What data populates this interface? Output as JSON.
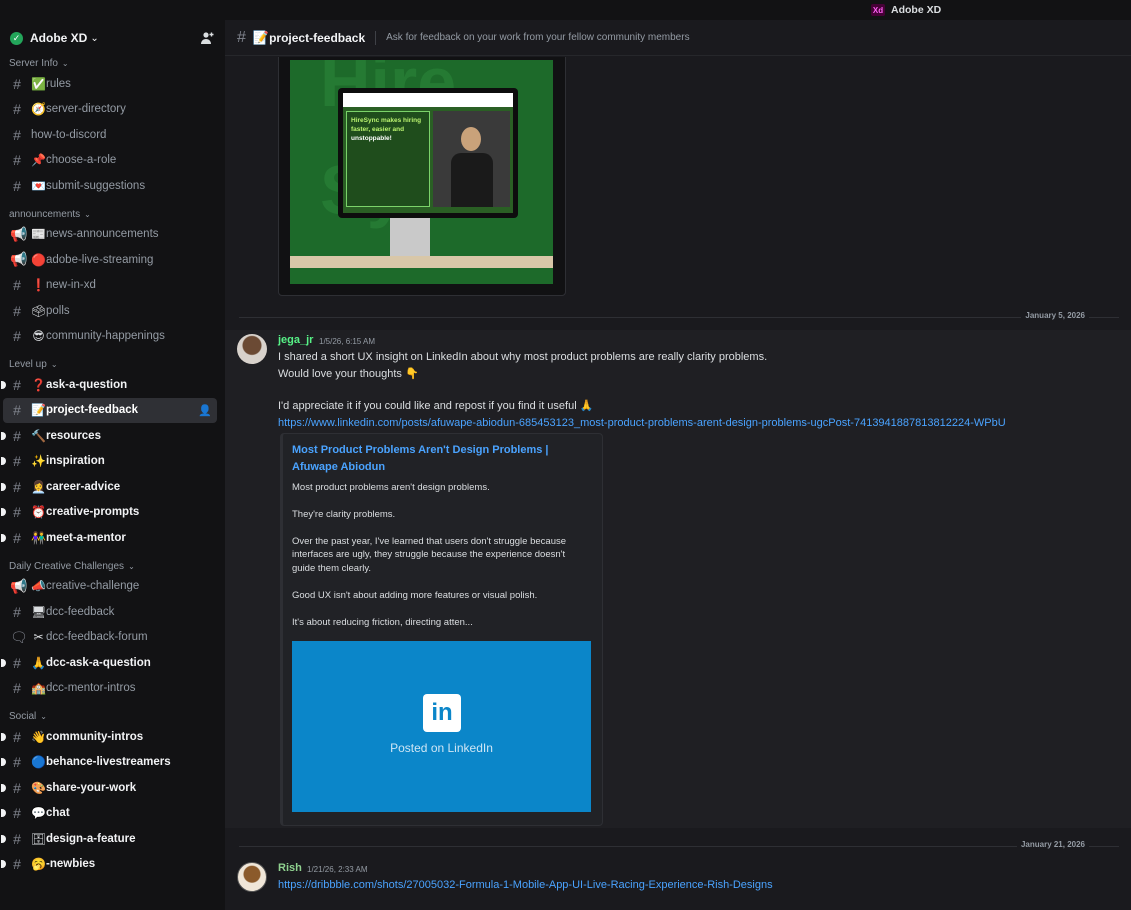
{
  "window": {
    "app_title": "Adobe XD",
    "logo": "Xd"
  },
  "server": {
    "name": "Adobe XD"
  },
  "categories": {
    "server_info": "Server Info",
    "announcements": "announcements",
    "level_up": "Level up",
    "daily": "Daily Creative Challenges",
    "social": "Social"
  },
  "channels": {
    "rules": {
      "emoji": "✅",
      "label": "rules"
    },
    "server_directory": {
      "emoji": "🧭",
      "label": "server-directory"
    },
    "how_to_discord": {
      "emoji": "",
      "label": "how-to-discord"
    },
    "choose_a_role": {
      "emoji": "📌",
      "label": "choose-a-role"
    },
    "submit_suggestions": {
      "emoji": "💌",
      "label": "submit-suggestions"
    },
    "news_announcements": {
      "emoji": "📰",
      "label": "news-announcements"
    },
    "adobe_live_streaming": {
      "emoji": "🔴",
      "label": "adobe-live-streaming"
    },
    "new_in_xd": {
      "emoji": "❗",
      "label": "new-in-xd"
    },
    "polls": {
      "emoji": "🗳",
      "label": "polls"
    },
    "community_happenings": {
      "emoji": "😎",
      "label": "community-happenings"
    },
    "ask_a_question": {
      "emoji": "❓",
      "label": "ask-a-question"
    },
    "project_feedback": {
      "emoji": "📝",
      "label": "project-feedback"
    },
    "resources": {
      "emoji": "🔨",
      "label": "resources"
    },
    "inspiration": {
      "emoji": "✨",
      "label": "inspiration"
    },
    "career_advice": {
      "emoji": "👩‍💼",
      "label": "career-advice"
    },
    "creative_prompts": {
      "emoji": "⏰",
      "label": "creative-prompts"
    },
    "meet_a_mentor": {
      "emoji": "👫",
      "label": "meet-a-mentor"
    },
    "creative_challenge": {
      "emoji": "📣",
      "label": "creative-challenge"
    },
    "dcc_feedback": {
      "emoji": "🖥",
      "label": "dcc-feedback"
    },
    "dcc_feedback_forum": {
      "emoji": "✂",
      "label": "dcc-feedback-forum"
    },
    "dcc_ask_a_question": {
      "emoji": "🙏",
      "label": "dcc-ask-a-question"
    },
    "dcc_mentor_intros": {
      "emoji": "🏫",
      "label": "dcc-mentor-intros"
    },
    "community_intros": {
      "emoji": "👋",
      "label": "community-intros"
    },
    "behance_livestreamers": {
      "emoji": "🔵",
      "label": "behance-livestreamers"
    },
    "share_your_work": {
      "emoji": "🎨",
      "label": "share-your-work"
    },
    "chat": {
      "emoji": "💬",
      "label": "chat"
    },
    "design_a_feature": {
      "emoji": "🗄",
      "label": "design-a-feature"
    },
    "newbies": {
      "emoji": "🥱",
      "label": "-newbies"
    }
  },
  "header": {
    "emoji": "📝",
    "channel": "project-feedback",
    "topic": "Ask for feedback on your work from your fellow community members"
  },
  "attachment": {
    "brand_word_1": "Hire",
    "brand_word_2": "Sync",
    "headline_1": "HireSync makes hiring",
    "headline_2": "faster, easier and",
    "headline_3": "unstoppable!"
  },
  "dividers": {
    "d1": "January 5, 2026",
    "d2": "January 21, 2026"
  },
  "messages": [
    {
      "author": "jega_jr",
      "timestamp": "1/5/26, 6:15 AM",
      "line1": "I shared a short UX insight on LinkedIn about why most product problems are really clarity problems.",
      "line2": "Would love your thoughts 👇",
      "line3": "I'd appreciate it if you could like and repost if you find it useful 🙏",
      "link": "https://www.linkedin.com/posts/afuwape-abiodun-685453123_most-product-problems-arent-design-problems-ugcPost-7413941887813812224-WPbU",
      "embed": {
        "title": "Most Product Problems Aren't Design Problems | Afuwape Abiodun",
        "desc1": "Most product problems aren't design problems.",
        "desc2": "They're clarity problems.",
        "desc3": "Over the past year, I've learned that users don't struggle because",
        "desc4": "interfaces are ugly, they struggle because the experience doesn't",
        "desc5": "guide them clearly.",
        "desc6": "Good UX isn't about adding more features or visual polish.",
        "desc7": "It's about reducing friction, directing atten...",
        "image_logo": "in",
        "image_caption": "Posted on LinkedIn"
      }
    },
    {
      "author": "Rish",
      "timestamp": "1/21/26, 2:33 AM",
      "link": "https://dribbble.com/shots/27005032-Formula-1-Mobile-App-UI-Live-Racing-Experience-Rish-Designs"
    }
  ],
  "colors": {
    "accent_green": "#57f287",
    "link": "#4aa3ff",
    "linkedin_blue": "#0b86c9"
  }
}
